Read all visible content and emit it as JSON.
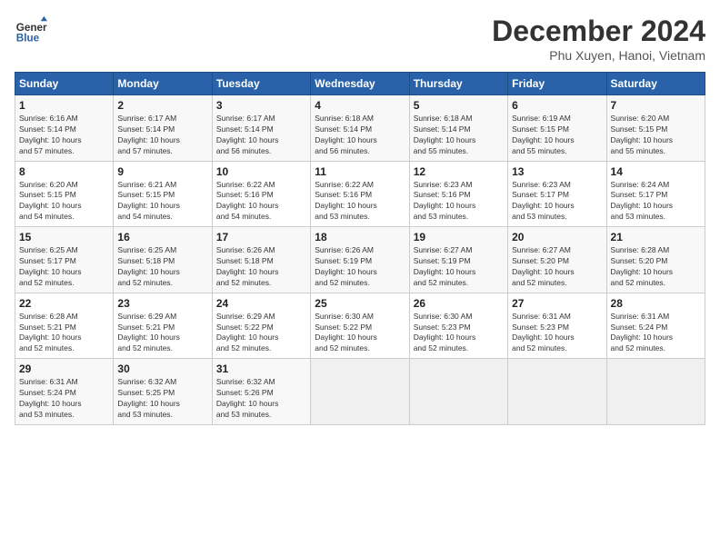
{
  "header": {
    "logo_line1": "General",
    "logo_line2": "Blue",
    "month": "December 2024",
    "location": "Phu Xuyen, Hanoi, Vietnam"
  },
  "weekdays": [
    "Sunday",
    "Monday",
    "Tuesday",
    "Wednesday",
    "Thursday",
    "Friday",
    "Saturday"
  ],
  "weeks": [
    [
      {
        "day": "1",
        "detail": "Sunrise: 6:16 AM\nSunset: 5:14 PM\nDaylight: 10 hours\nand 57 minutes."
      },
      {
        "day": "2",
        "detail": "Sunrise: 6:17 AM\nSunset: 5:14 PM\nDaylight: 10 hours\nand 57 minutes."
      },
      {
        "day": "3",
        "detail": "Sunrise: 6:17 AM\nSunset: 5:14 PM\nDaylight: 10 hours\nand 56 minutes."
      },
      {
        "day": "4",
        "detail": "Sunrise: 6:18 AM\nSunset: 5:14 PM\nDaylight: 10 hours\nand 56 minutes."
      },
      {
        "day": "5",
        "detail": "Sunrise: 6:18 AM\nSunset: 5:14 PM\nDaylight: 10 hours\nand 55 minutes."
      },
      {
        "day": "6",
        "detail": "Sunrise: 6:19 AM\nSunset: 5:15 PM\nDaylight: 10 hours\nand 55 minutes."
      },
      {
        "day": "7",
        "detail": "Sunrise: 6:20 AM\nSunset: 5:15 PM\nDaylight: 10 hours\nand 55 minutes."
      }
    ],
    [
      {
        "day": "8",
        "detail": "Sunrise: 6:20 AM\nSunset: 5:15 PM\nDaylight: 10 hours\nand 54 minutes."
      },
      {
        "day": "9",
        "detail": "Sunrise: 6:21 AM\nSunset: 5:15 PM\nDaylight: 10 hours\nand 54 minutes."
      },
      {
        "day": "10",
        "detail": "Sunrise: 6:22 AM\nSunset: 5:16 PM\nDaylight: 10 hours\nand 54 minutes."
      },
      {
        "day": "11",
        "detail": "Sunrise: 6:22 AM\nSunset: 5:16 PM\nDaylight: 10 hours\nand 53 minutes."
      },
      {
        "day": "12",
        "detail": "Sunrise: 6:23 AM\nSunset: 5:16 PM\nDaylight: 10 hours\nand 53 minutes."
      },
      {
        "day": "13",
        "detail": "Sunrise: 6:23 AM\nSunset: 5:17 PM\nDaylight: 10 hours\nand 53 minutes."
      },
      {
        "day": "14",
        "detail": "Sunrise: 6:24 AM\nSunset: 5:17 PM\nDaylight: 10 hours\nand 53 minutes."
      }
    ],
    [
      {
        "day": "15",
        "detail": "Sunrise: 6:25 AM\nSunset: 5:17 PM\nDaylight: 10 hours\nand 52 minutes."
      },
      {
        "day": "16",
        "detail": "Sunrise: 6:25 AM\nSunset: 5:18 PM\nDaylight: 10 hours\nand 52 minutes."
      },
      {
        "day": "17",
        "detail": "Sunrise: 6:26 AM\nSunset: 5:18 PM\nDaylight: 10 hours\nand 52 minutes."
      },
      {
        "day": "18",
        "detail": "Sunrise: 6:26 AM\nSunset: 5:19 PM\nDaylight: 10 hours\nand 52 minutes."
      },
      {
        "day": "19",
        "detail": "Sunrise: 6:27 AM\nSunset: 5:19 PM\nDaylight: 10 hours\nand 52 minutes."
      },
      {
        "day": "20",
        "detail": "Sunrise: 6:27 AM\nSunset: 5:20 PM\nDaylight: 10 hours\nand 52 minutes."
      },
      {
        "day": "21",
        "detail": "Sunrise: 6:28 AM\nSunset: 5:20 PM\nDaylight: 10 hours\nand 52 minutes."
      }
    ],
    [
      {
        "day": "22",
        "detail": "Sunrise: 6:28 AM\nSunset: 5:21 PM\nDaylight: 10 hours\nand 52 minutes."
      },
      {
        "day": "23",
        "detail": "Sunrise: 6:29 AM\nSunset: 5:21 PM\nDaylight: 10 hours\nand 52 minutes."
      },
      {
        "day": "24",
        "detail": "Sunrise: 6:29 AM\nSunset: 5:22 PM\nDaylight: 10 hours\nand 52 minutes."
      },
      {
        "day": "25",
        "detail": "Sunrise: 6:30 AM\nSunset: 5:22 PM\nDaylight: 10 hours\nand 52 minutes."
      },
      {
        "day": "26",
        "detail": "Sunrise: 6:30 AM\nSunset: 5:23 PM\nDaylight: 10 hours\nand 52 minutes."
      },
      {
        "day": "27",
        "detail": "Sunrise: 6:31 AM\nSunset: 5:23 PM\nDaylight: 10 hours\nand 52 minutes."
      },
      {
        "day": "28",
        "detail": "Sunrise: 6:31 AM\nSunset: 5:24 PM\nDaylight: 10 hours\nand 52 minutes."
      }
    ],
    [
      {
        "day": "29",
        "detail": "Sunrise: 6:31 AM\nSunset: 5:24 PM\nDaylight: 10 hours\nand 53 minutes."
      },
      {
        "day": "30",
        "detail": "Sunrise: 6:32 AM\nSunset: 5:25 PM\nDaylight: 10 hours\nand 53 minutes."
      },
      {
        "day": "31",
        "detail": "Sunrise: 6:32 AM\nSunset: 5:26 PM\nDaylight: 10 hours\nand 53 minutes."
      },
      {
        "day": "",
        "detail": ""
      },
      {
        "day": "",
        "detail": ""
      },
      {
        "day": "",
        "detail": ""
      },
      {
        "day": "",
        "detail": ""
      }
    ]
  ]
}
